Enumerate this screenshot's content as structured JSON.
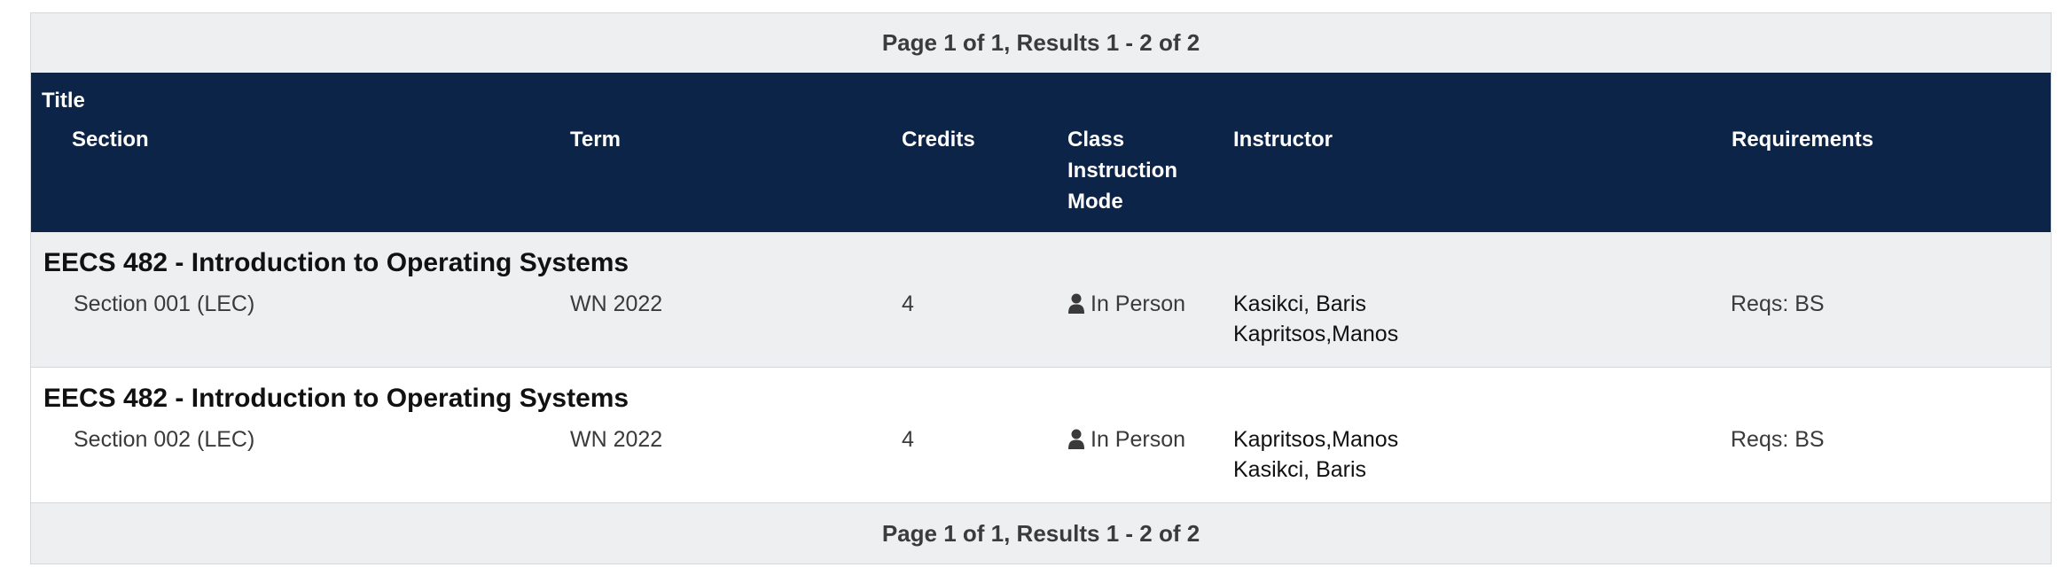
{
  "pager": {
    "top": "Page 1 of 1, Results 1 - 2 of 2",
    "bottom": "Page 1 of 1, Results 1 - 2 of 2"
  },
  "header": {
    "title": "Title",
    "section": "Section",
    "term": "Term",
    "credits": "Credits",
    "mode_line1": "Class",
    "mode_line2": "Instruction",
    "mode_line3": "Mode",
    "instructor": "Instructor",
    "requirements": "Requirements"
  },
  "courses": [
    {
      "title": "EECS 482 - Introduction to Operating Systems",
      "section": "Section 001 (LEC)",
      "term": "WN 2022",
      "credits": "4",
      "mode": "In Person",
      "mode_icon": "person-icon",
      "instructors": [
        "Kasikci, Baris",
        "Kapritsos,Manos"
      ],
      "requirements": "Reqs: BS"
    },
    {
      "title": "EECS 482 - Introduction to Operating Systems",
      "section": "Section 002 (LEC)",
      "term": "WN 2022",
      "credits": "4",
      "mode": "In Person",
      "mode_icon": "person-icon",
      "instructors": [
        "Kapritsos,Manos",
        "Kasikci, Baris"
      ],
      "requirements": "Reqs: BS"
    }
  ],
  "colors": {
    "header_bg": "#0b2447",
    "stripe_bg": "#eeeff1"
  }
}
